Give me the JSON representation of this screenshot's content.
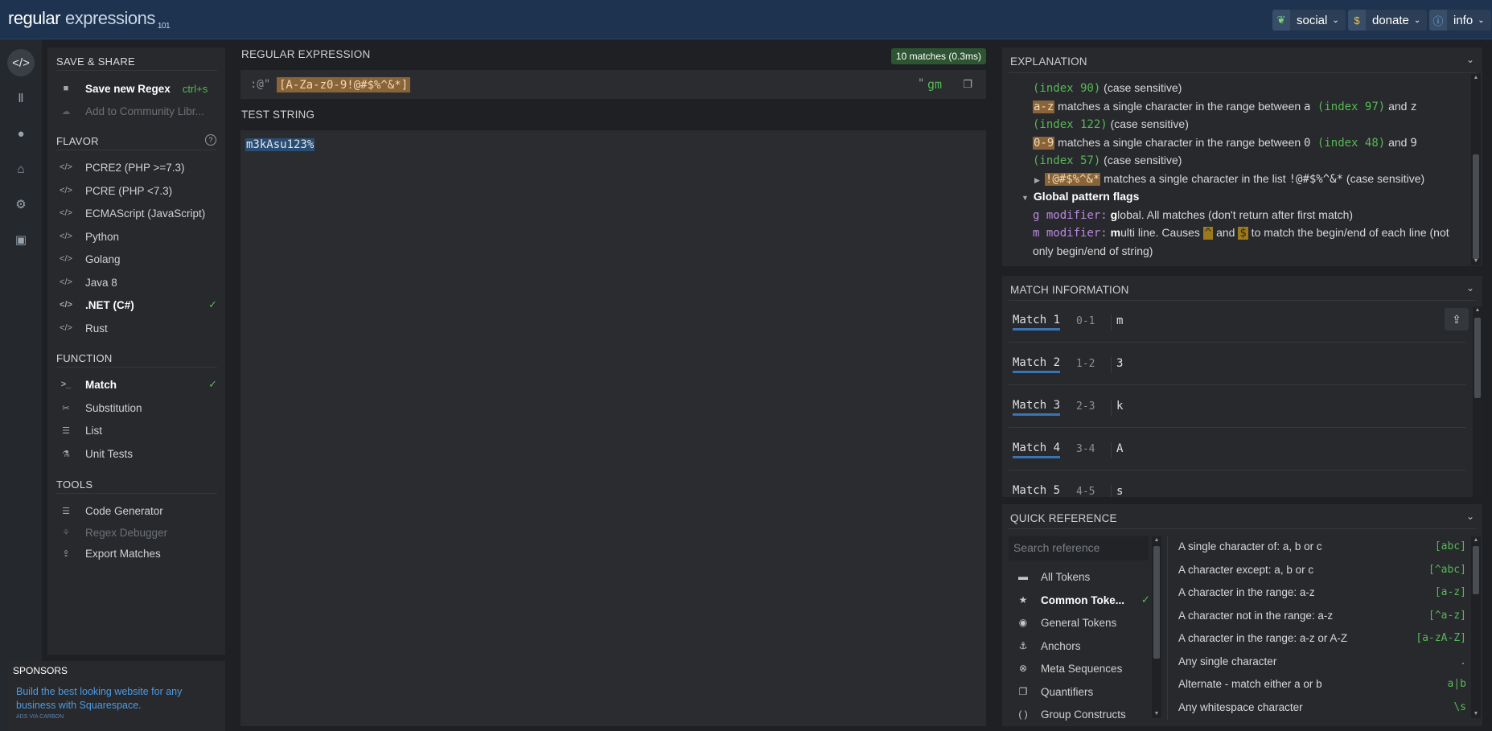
{
  "logo": {
    "main": "regular",
    "second": "expressions",
    "version": "101"
  },
  "topbar": {
    "social": {
      "icon": "leaf-icon",
      "label": "social"
    },
    "donate": {
      "icon": "dollar-icon",
      "label": "donate"
    },
    "info": {
      "icon": "info-icon",
      "label": "info"
    }
  },
  "save_share": {
    "heading": "SAVE & SHARE",
    "save_label": "Save new Regex",
    "save_shortcut": "ctrl+s",
    "community_label": "Add to Community Libr..."
  },
  "flavor": {
    "heading": "FLAVOR",
    "help_icon": "help-circle-icon",
    "items": [
      {
        "label": "PCRE2 (PHP >=7.3)",
        "selected": false
      },
      {
        "label": "PCRE (PHP <7.3)",
        "selected": false
      },
      {
        "label": "ECMAScript (JavaScript)",
        "selected": false
      },
      {
        "label": "Python",
        "selected": false
      },
      {
        "label": "Golang",
        "selected": false
      },
      {
        "label": "Java 8",
        "selected": false
      },
      {
        "label": ".NET (C#)",
        "selected": true
      },
      {
        "label": "Rust",
        "selected": false
      }
    ]
  },
  "function": {
    "heading": "FUNCTION",
    "items": [
      {
        "label": "Match",
        "icon": "terminal-icon",
        "selected": true
      },
      {
        "label": "Substitution",
        "icon": "scissors-icon",
        "selected": false
      },
      {
        "label": "List",
        "icon": "list-icon",
        "selected": false
      },
      {
        "label": "Unit Tests",
        "icon": "flask-icon",
        "selected": false
      }
    ]
  },
  "tools": {
    "heading": "TOOLS",
    "items": [
      {
        "label": "Code Generator",
        "icon": "code-file-icon",
        "enabled": true
      },
      {
        "label": "Regex Debugger",
        "icon": "bug-icon",
        "enabled": false
      },
      {
        "label": "Export Matches",
        "icon": "export-icon",
        "enabled": true
      }
    ]
  },
  "sponsors": {
    "heading": "SPONSORS",
    "text": "Build the best looking website for any business with Squarespace.",
    "small": "ADS VIA CARBON"
  },
  "regex": {
    "heading": "REGULAR EXPRESSION",
    "match_badge": "10 matches (0.3ms)",
    "delimiter": ":@\"",
    "pattern": "[A-Za-z0-9!@#$%^&*]",
    "flag_quote": "\"",
    "flags": "gm"
  },
  "test": {
    "heading": "TEST STRING",
    "value": "m3kAsu123%"
  },
  "explanation": {
    "heading": "EXPLANATION",
    "lines": {
      "l1_idx": "(index 90)",
      "l1_txt": " (case sensitive)",
      "l2_tok": "a-z",
      "l2_txt": " matches a single character in the range between ",
      "l2_a": "a",
      "l2_idx": " (index 97)",
      "l2_and": " and ",
      "l2_z": "z",
      "l3_idx": "(index 122)",
      "l3_txt": " (case sensitive)",
      "l4_tok": "0-9",
      "l4_txt": " matches a single character in the range between ",
      "l4_a": "0",
      "l4_idx": " (index 48)",
      "l4_and": " and ",
      "l4_z": "9",
      "l5_idx": "(index 57)",
      "l5_txt": " (case sensitive)",
      "l6_tok": "!@#$%^&*",
      "l6_txt": " matches a single character in the list ",
      "l6_list": "!@#$%^&*",
      "l6_end": " (case sensitive)",
      "l7": "Global pattern flags",
      "l8_mod": "g modifier:",
      "l8_b": " g",
      "l8_txt": "lobal. All matches (don't return after first match)",
      "l9_mod": "m modifier:",
      "l9_b": " m",
      "l9_txt": "ulti line. Causes ",
      "l9_caret": "^",
      "l9_and": " and ",
      "l9_dollar": "$",
      "l9_end": " to match the begin/end of each line (not",
      "l10": "only begin/end of string)"
    }
  },
  "match_info": {
    "heading": "MATCH INFORMATION",
    "matches": [
      {
        "name": "Match 1",
        "range": "0-1",
        "value": "m"
      },
      {
        "name": "Match 2",
        "range": "1-2",
        "value": "3"
      },
      {
        "name": "Match 3",
        "range": "2-3",
        "value": "k"
      },
      {
        "name": "Match 4",
        "range": "3-4",
        "value": "A"
      },
      {
        "name": "Match 5",
        "range": "4-5",
        "value": "s"
      }
    ]
  },
  "quick_ref": {
    "heading": "QUICK REFERENCE",
    "search_placeholder": "Search reference",
    "categories": [
      {
        "label": "All Tokens",
        "icon": "tokens-icon",
        "selected": false
      },
      {
        "label": "Common Toke...",
        "icon": "star-icon",
        "selected": true
      },
      {
        "label": "General Tokens",
        "icon": "target-icon",
        "selected": false
      },
      {
        "label": "Anchors",
        "icon": "anchor-icon",
        "selected": false
      },
      {
        "label": "Meta Sequences",
        "icon": "meta-icon",
        "selected": false
      },
      {
        "label": "Quantifiers",
        "icon": "quantifier-icon",
        "selected": false
      },
      {
        "label": "Group Constructs",
        "icon": "parentheses-icon",
        "selected": false
      }
    ],
    "rows": [
      {
        "desc": "A single character of: a, b or c",
        "token": "[abc]"
      },
      {
        "desc": "A character except: a, b or c",
        "token": "[^abc]"
      },
      {
        "desc": "A character in the range: a-z",
        "token": "[a-z]"
      },
      {
        "desc": "A character not in the range: a-z",
        "token": "[^a-z]"
      },
      {
        "desc": "A character in the range: a-z or A-Z",
        "token": "[a-zA-Z]"
      },
      {
        "desc": "Any single character",
        "token": "."
      },
      {
        "desc": "Alternate - match either a or b",
        "token": "a|b"
      },
      {
        "desc": "Any whitespace character",
        "token": "\\s"
      }
    ]
  },
  "colors": {
    "topbar": "#1d3350",
    "accent_green": "#57b957",
    "accent_blue": "#3b74b5",
    "token_highlight": "#8a6439"
  }
}
